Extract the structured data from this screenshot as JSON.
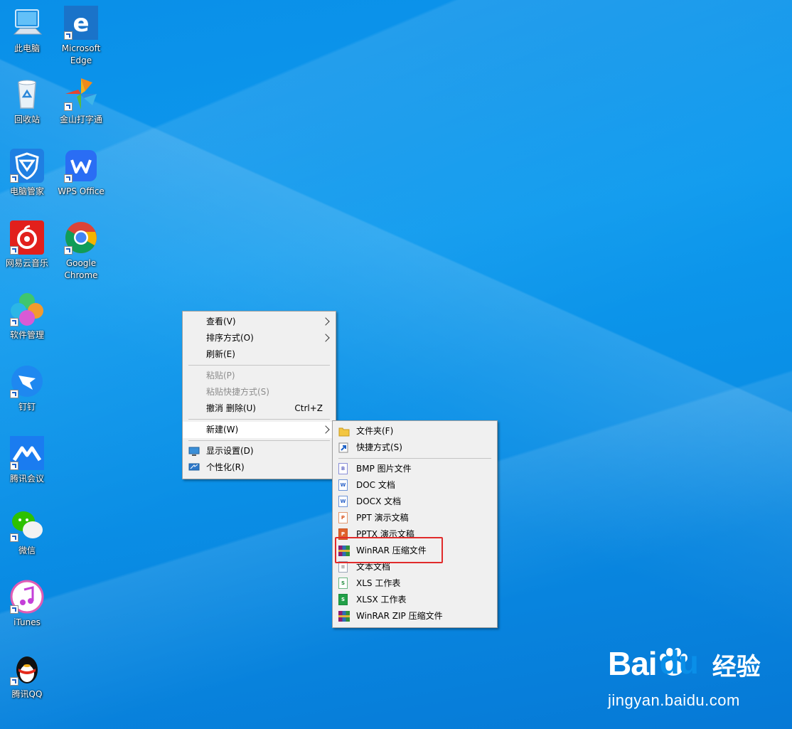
{
  "desktop": {
    "icons": [
      {
        "label": "此电脑",
        "icon": "computer-icon"
      },
      {
        "label": "Microsoft\nEdge",
        "icon": "edge-icon"
      },
      {
        "label": "回收站",
        "icon": "recycle-bin-icon"
      },
      {
        "label": "金山打字通",
        "icon": "kingsoft-typing-icon"
      },
      {
        "label": "电脑管家",
        "icon": "pc-manager-icon"
      },
      {
        "label": "WPS Office",
        "icon": "wps-icon"
      },
      {
        "label": "网易云音乐",
        "icon": "netease-music-icon"
      },
      {
        "label": "Google\nChrome",
        "icon": "chrome-icon"
      },
      {
        "label": "软件管理",
        "icon": "software-manager-icon"
      },
      {
        "label": "钉钉",
        "icon": "dingtalk-icon"
      },
      {
        "label": "腾讯会议",
        "icon": "tencent-meeting-icon"
      },
      {
        "label": "微信",
        "icon": "wechat-icon"
      },
      {
        "label": "iTunes",
        "icon": "itunes-icon"
      },
      {
        "label": "腾讯QQ",
        "icon": "qq-icon"
      }
    ]
  },
  "context_menu": {
    "view": "查看(V)",
    "sort": "排序方式(O)",
    "refresh": "刷新(E)",
    "paste": "粘贴(P)",
    "paste_shortcut": "粘贴快捷方式(S)",
    "undo": "撤消 删除(U)",
    "undo_shortcut": "Ctrl+Z",
    "new": "新建(W)",
    "display": "显示设置(D)",
    "personalize": "个性化(R)"
  },
  "new_submenu": {
    "folder": "文件夹(F)",
    "shortcut": "快捷方式(S)",
    "bmp": "BMP 图片文件",
    "doc": "DOC 文档",
    "docx": "DOCX 文档",
    "ppt": "PPT 演示文稿",
    "pptx": "PPTX 演示文稿",
    "winrar": "WinRAR 压缩文件",
    "txt": "文本文档",
    "xls": "XLS 工作表",
    "xlsx": "XLSX 工作表",
    "winrar_zip": "WinRAR ZIP 压缩文件"
  },
  "watermark": {
    "brand_left": "Bai",
    "brand_right": "du",
    "brand_cn": "经验",
    "url": "jingyan.baidu.com"
  },
  "colors": {
    "highlight": "#e02b2b",
    "desktop": "#0a8fe8"
  }
}
